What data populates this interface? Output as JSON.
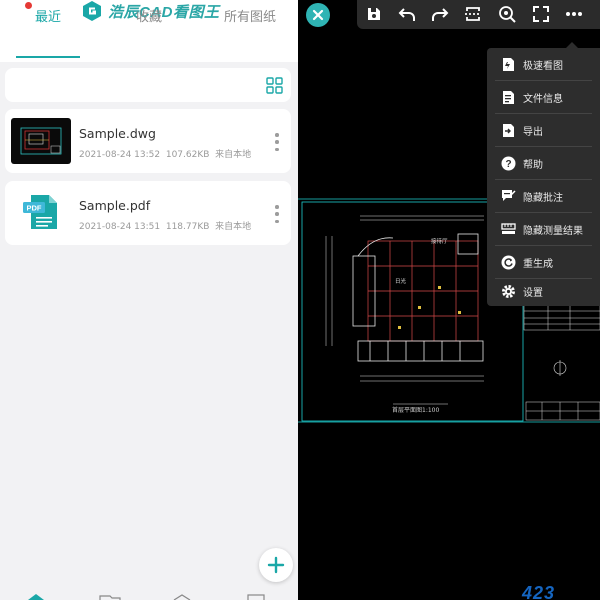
{
  "app": {
    "title": "浩辰CAD看图王",
    "brand_color": "#1aa7a7"
  },
  "tabs": [
    {
      "label": "最近",
      "active": true
    },
    {
      "label": "收藏",
      "active": false
    },
    {
      "label": "所有图纸",
      "active": false
    }
  ],
  "files": [
    {
      "name": "Sample.dwg",
      "date": "2021-08-24 13:52",
      "size": "107.62KB",
      "source": "来自本地",
      "icon": "dwg-thumbnail"
    },
    {
      "name": "Sample.pdf",
      "date": "2021-08-24 13:51",
      "size": "118.77KB",
      "source": "来自本地",
      "icon": "pdf-file-icon"
    }
  ],
  "viewer": {
    "toolbar_icons": [
      "save-icon",
      "undo-icon",
      "redo-icon",
      "layout-icon",
      "zoom-extents-icon",
      "fullscreen-icon",
      "more-icon"
    ],
    "menu": [
      {
        "label": "极速看图",
        "icon": "fast-view-icon"
      },
      {
        "label": "文件信息",
        "icon": "file-info-icon"
      },
      {
        "label": "导出",
        "icon": "export-icon"
      },
      {
        "label": "帮助",
        "icon": "help-icon"
      },
      {
        "label": "隐藏批注",
        "icon": "hide-annotation-icon"
      },
      {
        "label": "隐藏测量结果",
        "icon": "hide-measure-icon"
      },
      {
        "label": "重生成",
        "icon": "regenerate-icon"
      },
      {
        "label": "设置",
        "icon": "settings-icon"
      }
    ],
    "drawing_labels": {
      "title": "首层平面图1:100",
      "room": "接待厅",
      "room2": "日光"
    }
  },
  "watermark": "423"
}
